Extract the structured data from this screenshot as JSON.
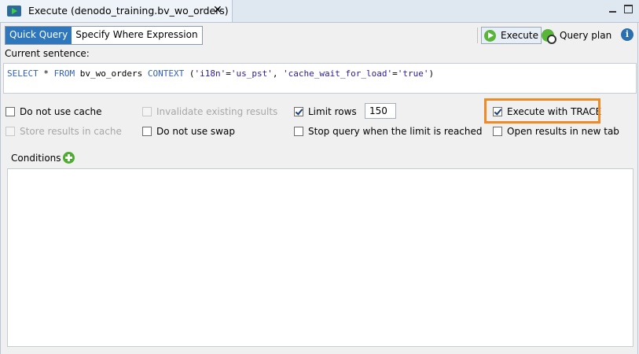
{
  "tab": {
    "title": "Execute (denodo_training.bv_wo_orders)",
    "close_glyph": "✕"
  },
  "mode_tabs": [
    {
      "label": "Quick Query",
      "active": true
    },
    {
      "label": "Specify Where Expression",
      "active": false
    }
  ],
  "toolbar": {
    "execute_label": "Execute",
    "query_plan_label": "Query plan",
    "info_glyph": "i"
  },
  "query": {
    "label": "Current sentence:",
    "parts": {
      "kw1": "SELECT",
      "t1": " * ",
      "kw2": "FROM",
      "t2": " bv_wo_orders ",
      "kw3": "CONTEXT",
      "t3": " (",
      "s1": "'i18n'",
      "t4": "=",
      "s2": "'us_pst'",
      "t5": ", ",
      "s3": "'cache_wait_for_load'",
      "t6": "=",
      "s4": "'true'",
      "t7": ")"
    }
  },
  "options": {
    "do_not_use_cache": {
      "label": "Do not use cache",
      "checked": false
    },
    "invalidate_existing": {
      "label": "Invalidate existing results",
      "checked": false,
      "disabled": true
    },
    "limit_rows": {
      "label": "Limit rows",
      "checked": true,
      "value": "150"
    },
    "execute_with_trace": {
      "label": "Execute with TRACE",
      "checked": true
    },
    "store_results_in_cache": {
      "label": "Store results in cache",
      "checked": false,
      "disabled": true
    },
    "do_not_use_swap": {
      "label": "Do not use swap",
      "checked": false
    },
    "stop_query_limit": {
      "label": "Stop query when the limit is reached",
      "checked": false
    },
    "open_results_new_tab": {
      "label": "Open results in new tab",
      "checked": false
    }
  },
  "conditions": {
    "label": "Conditions"
  },
  "colors": {
    "accent_tab": "#2f77bd",
    "highlight": "#f08a24",
    "play_green": "#59b43a",
    "info_blue": "#2a6fb0"
  }
}
